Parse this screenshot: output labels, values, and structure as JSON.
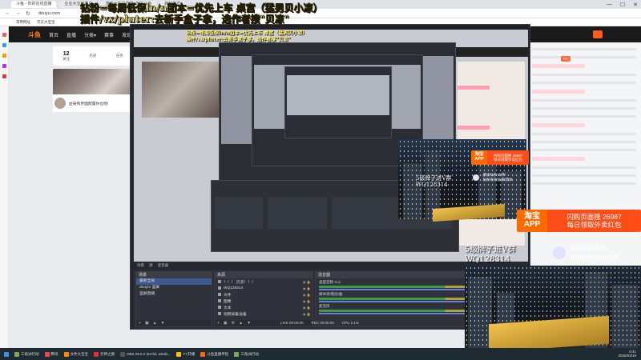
{
  "browser": {
    "tabs": [
      "斗鱼 - 你的在线直播",
      "企业大宝宝黑白",
      "游戏大宝宝直播_你的斗鱼",
      "新标签页"
    ],
    "url": "douyu.com",
    "bookmarks": [
      "常用网址",
      "京东大宝宝",
      "分类▾",
      "直播"
    ]
  },
  "site": {
    "logo": "斗鱼",
    "nav": [
      "首页",
      "直播",
      "分类▾",
      "赛事",
      "发现"
    ],
    "stats": [
      {
        "value": "12",
        "label": "关注"
      },
      {
        "value": "",
        "label": "历史"
      },
      {
        "value": "",
        "label": "任务"
      }
    ],
    "user_text": "血染和界面配置你也吧!"
  },
  "overlay": {
    "line1": "钻粉=每周低保ln/n团本=优先上车  桌宫（猛男贝小凉）",
    "line2": "插件/vx/pluter:去新手盒子拿，选作者搜\"贝凉\"",
    "promo_big": {
      "line1": "5级牌子进V群",
      "line2": "WQ128314"
    },
    "promo_small": {
      "line1": "5级牌子进V群",
      "line2": "WQ128314"
    },
    "ad_big": {
      "left1": "淘宝",
      "left2": "APP",
      "right1": "闪购页面搜 26987",
      "right2": "每日领取外卖红包"
    },
    "ad_small": {
      "left1": "淘宝",
      "left2": "APP",
      "right1": "闪购页面搜 26987",
      "right2": "每日领取外卖红包"
    },
    "thanks_big": {
      "line1": "感谢钻粉支持！",
      "line2": "钻粉每周低保/团本"
    },
    "thanks_small": {
      "line1": "感谢钻粉支持！",
      "line2": "钻粉每周低保/团本"
    }
  },
  "obs": {
    "toolbar": [
      "场景",
      "源",
      "混音器",
      "转场",
      "控制"
    ],
    "scenes_title": "场景",
    "scenes": [
      "最新全局",
      "douyin 竖屏",
      "竖屏直播"
    ],
    "sources_title": "来源",
    "sources": [
      "！！！ 贝凉！！！",
      "WQ128314",
      "文件",
      "图像",
      "文本",
      "视频采集设备"
    ],
    "mixer_title": "混音器",
    "mixer": [
      {
        "label": "桌面音频 Aux",
        "db": "-0.0 dB"
      },
      {
        "label": "媒体源/图层/曲",
        "db": "-0.0 dB"
      },
      {
        "label": "麦克风",
        "db": "-11.4 dB"
      }
    ],
    "status": [
      "LIVE 00:00:00",
      "REC 00:00:00",
      "CPU 2.1%"
    ]
  },
  "taskbar": {
    "items": [
      "三角洲行动",
      "腾讯",
      "文件大宝宝",
      "元神之图",
      "OBS 29.0.2 (64-bit, windo...",
      "YY开播",
      "斗鱼直播伴侣",
      "三角洲行动"
    ],
    "time": "0:41",
    "date": "2025/03/19"
  }
}
